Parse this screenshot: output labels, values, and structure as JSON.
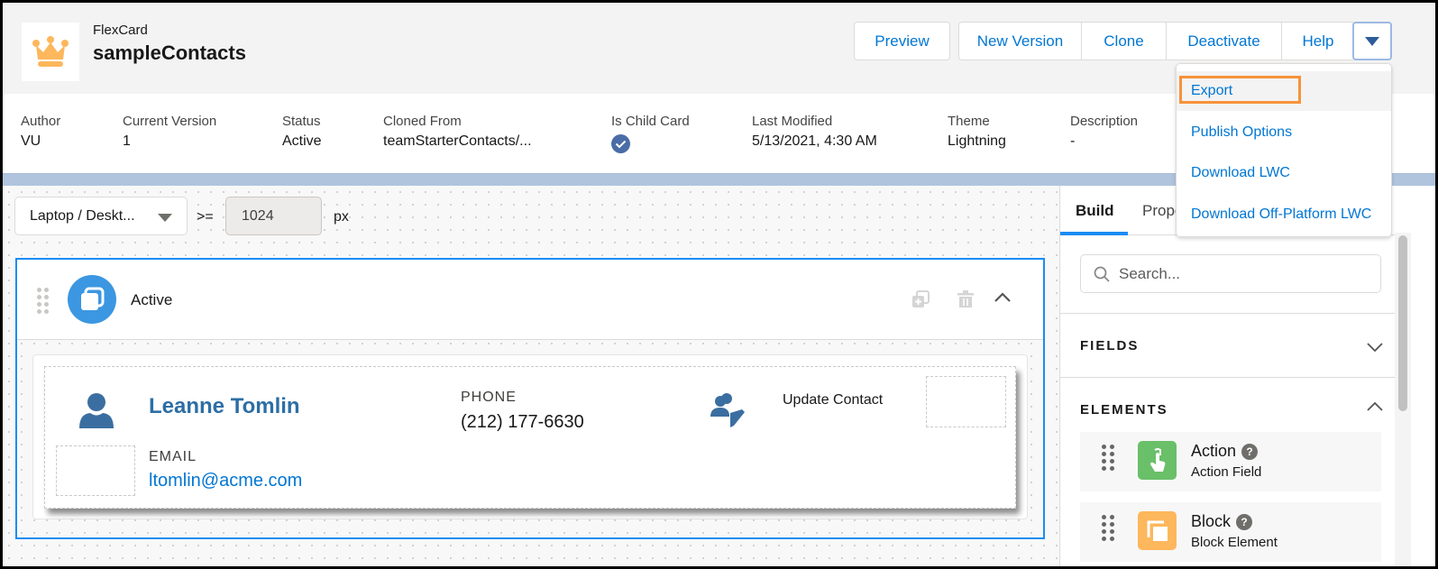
{
  "header": {
    "app_type": "FlexCard",
    "title": "sampleContacts",
    "logo_icon": "crown-icon",
    "buttons": {
      "preview": "Preview",
      "new_version": "New Version",
      "clone": "Clone",
      "deactivate": "Deactivate",
      "help": "Help"
    },
    "dropdown_icon": "caret-down-icon"
  },
  "info": [
    {
      "label": "Author",
      "value": "VU"
    },
    {
      "label": "Current Version",
      "value": "1"
    },
    {
      "label": "Status",
      "value": "Active"
    },
    {
      "label": "Cloned From",
      "value": "teamStarterContacts/..."
    },
    {
      "label": "Is Child Card",
      "value": ""
    },
    {
      "label": "Last Modified",
      "value": "5/13/2021, 4:30 AM"
    },
    {
      "label": "Theme",
      "value": "Lightning"
    },
    {
      "label": "Description",
      "value": "-"
    }
  ],
  "menu": {
    "items": [
      "Export",
      "Publish Options",
      "Download LWC",
      "Download Off-Platform LWC"
    ],
    "highlight_color": "#f7923a"
  },
  "canvas": {
    "device": "Laptop / Deskt...",
    "operator": ">=",
    "width_value": "1024",
    "unit": "px",
    "state": {
      "name": "Active"
    },
    "card": {
      "name": "Leanne Tomlin",
      "phone_label": "PHONE",
      "phone": "(212) 177-6630",
      "email_label": "EMAIL",
      "email": "ltomlin@acme.com",
      "action_label": "Update Contact"
    }
  },
  "panel": {
    "tabs": [
      "Build",
      "Prope"
    ],
    "search_placeholder": "Search...",
    "sections": {
      "fields": "FIELDS",
      "elements": "ELEMENTS"
    },
    "elements": [
      {
        "name": "Action",
        "sub": "Action Field",
        "color": "#6abf69"
      },
      {
        "name": "Block",
        "sub": "Block Element",
        "color": "#fdb75c"
      }
    ]
  },
  "colors": {
    "brand_blue": "#0176d3",
    "selection_blue": "#1b8cf3",
    "contact_blue": "#2d6ea5"
  }
}
